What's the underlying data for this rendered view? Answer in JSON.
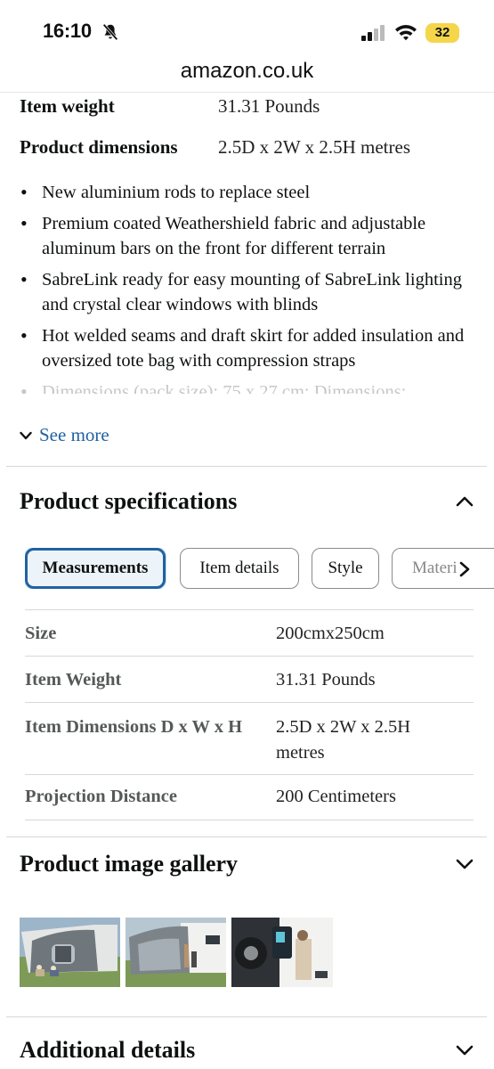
{
  "status_bar": {
    "time": "16:10",
    "battery": "32"
  },
  "browser": {
    "url": "amazon.co.uk"
  },
  "top_details": [
    {
      "label": "Item weight",
      "value": "31.31 Pounds"
    },
    {
      "label": "Product dimensions",
      "value": "2.5D x 2W x 2.5H metres"
    }
  ],
  "bullets": [
    "New aluminium rods to replace steel",
    "Premium coated Weathershield fabric and adjustable aluminum bars on the front for different terrain",
    "SabreLink ready for easy mounting of SabreLink lighting and crystal clear windows with blinds",
    "Hot welded seams and draft skirt for added insulation and oversized tote bag with compression straps",
    "Dimensions (pack size): 75 x 27 cm; Dimensions:"
  ],
  "see_more": "See more",
  "product_specifications": {
    "title": "Product specifications",
    "tabs": [
      "Measurements",
      "Item details",
      "Style",
      "Materi"
    ],
    "active_tab": "Measurements",
    "rows": [
      {
        "label": "Size",
        "value": "200cmx250cm"
      },
      {
        "label": "Item Weight",
        "value": "31.31 Pounds"
      },
      {
        "label": "Item Dimensions D x W x H",
        "value": "2.5D x 2W x 2.5H metres"
      },
      {
        "label": "Projection Distance",
        "value": "200 Centimeters"
      }
    ]
  },
  "gallery": {
    "title": "Product image gallery",
    "image_count": 3
  },
  "additional": {
    "title": "Additional details"
  },
  "colors": {
    "link": "#2162a1",
    "active_tab_border": "#2162a1",
    "battery": "#f5d64b",
    "divider": "#d5d9d9"
  }
}
